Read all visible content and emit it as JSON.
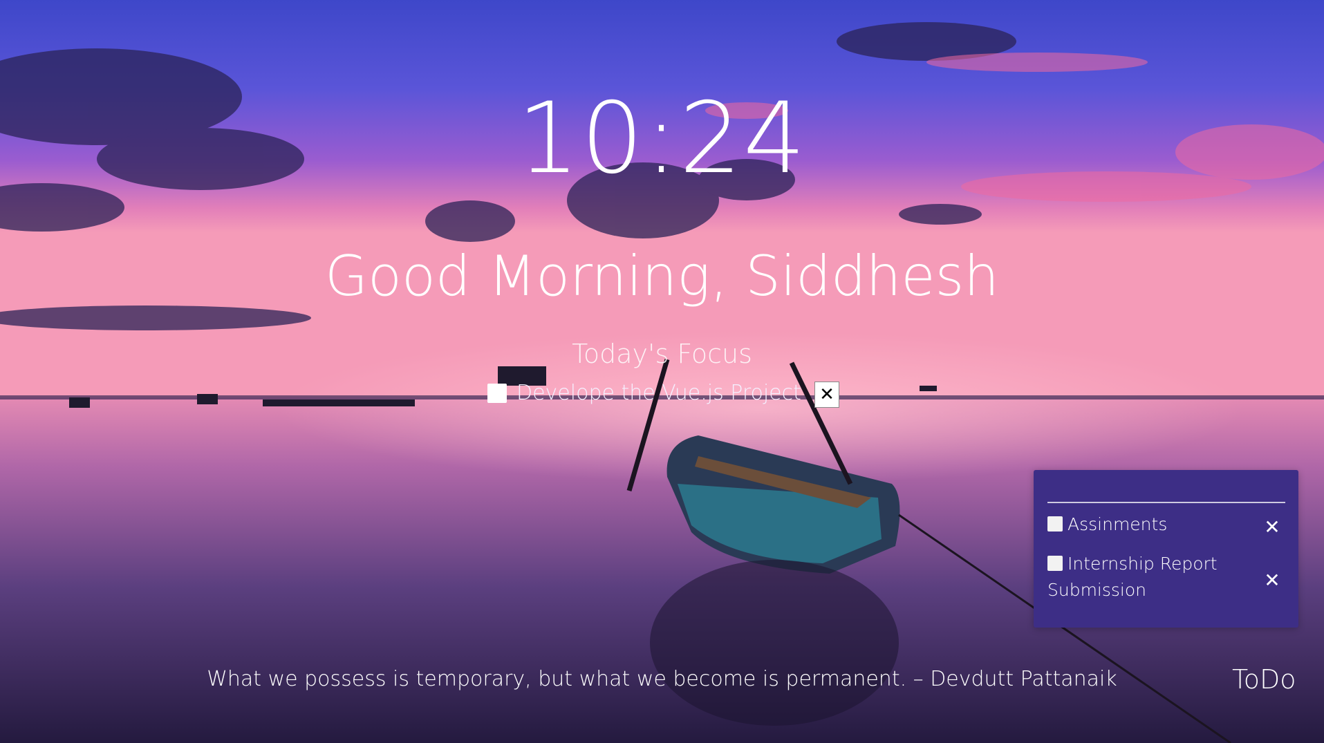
{
  "clock": {
    "time": "10:24"
  },
  "greeting": {
    "text": "Good Morning, Siddhesh"
  },
  "focus": {
    "heading": "Today's Focus",
    "task": "Develope the Vue.js Project",
    "checked": false,
    "close_icon": "close-icon"
  },
  "todo_panel": {
    "background": "#3d2e86",
    "items": [
      {
        "label": "Assinments",
        "checked": false
      },
      {
        "label": "Internship Report Submission",
        "checked": false
      }
    ],
    "remove_icon": "close-icon"
  },
  "quote": {
    "text": "What we possess is temporary, but what we become is permanent. – Devdutt Pattanaik"
  },
  "toggle": {
    "label": "ToDo"
  },
  "background": {
    "description_colors": [
      "#4f4ad8",
      "#c14fb7",
      "#f28aa8",
      "#2a2250"
    ]
  }
}
